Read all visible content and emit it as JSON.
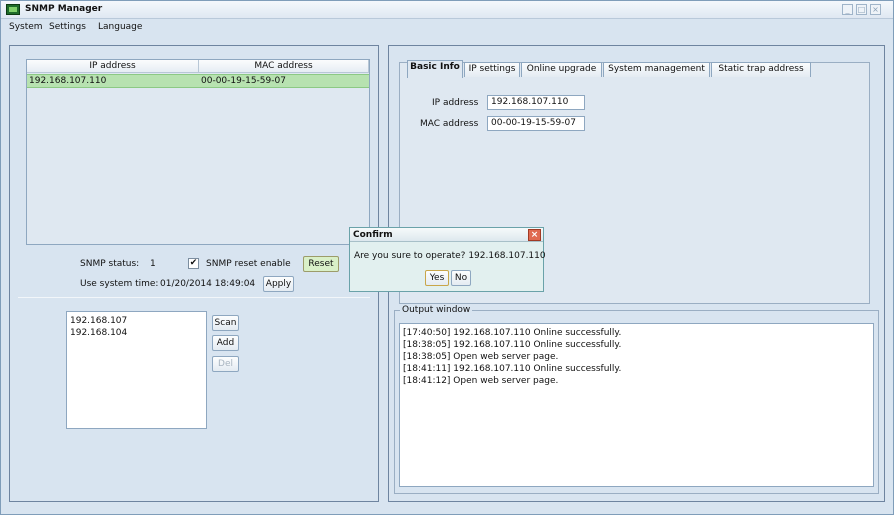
{
  "window": {
    "title": "SNMP Manager"
  },
  "menu": [
    "System",
    "Settings",
    "Language"
  ],
  "device_table": {
    "headers": [
      "IP address",
      "MAC address"
    ],
    "rows": [
      [
        "192.168.107.110",
        "00-00-19-15-59-07"
      ]
    ]
  },
  "snmp": {
    "status_label": "SNMP status:",
    "status_value": "1",
    "reset_enable_label": "SNMP reset enable",
    "reset_enable_checked": true,
    "reset_button": "Reset",
    "use_time_label": "Use system time:",
    "time_value": "01/20/2014 18:49:04",
    "apply_button": "Apply"
  },
  "subnets": {
    "items": [
      "192.168.107",
      "192.168.104"
    ],
    "scan_button": "Scan",
    "add_button": "Add",
    "del_button": "Del"
  },
  "tabs": [
    "Basic Info",
    "IP settings",
    "Online upgrade",
    "System management",
    "Static trap address"
  ],
  "active_tab": "Basic Info",
  "basic_info": {
    "ip_label": "IP address",
    "ip_value": "192.168.107.110",
    "mac_label": "MAC address",
    "mac_value": "00-00-19-15-59-07"
  },
  "output": {
    "title": "Output window",
    "lines": [
      "[17:40:50]   192.168.107.110 Online successfully.",
      "[18:38:05]   192.168.107.110 Online successfully.",
      "[18:38:05]   Open web server page.",
      "[18:41:11]   192.168.107.110 Online successfully.",
      "[18:41:12]   Open web server page."
    ]
  },
  "dialog": {
    "title": "Confirm",
    "message": "Are you sure to operate? 192.168.107.110",
    "yes": "Yes",
    "no": "No"
  },
  "colors": {
    "selected_row": "#b7e2b0",
    "background": "#d8e4f0",
    "dialog_bg": "#e2f0ef",
    "close_button": "#e06a50"
  }
}
